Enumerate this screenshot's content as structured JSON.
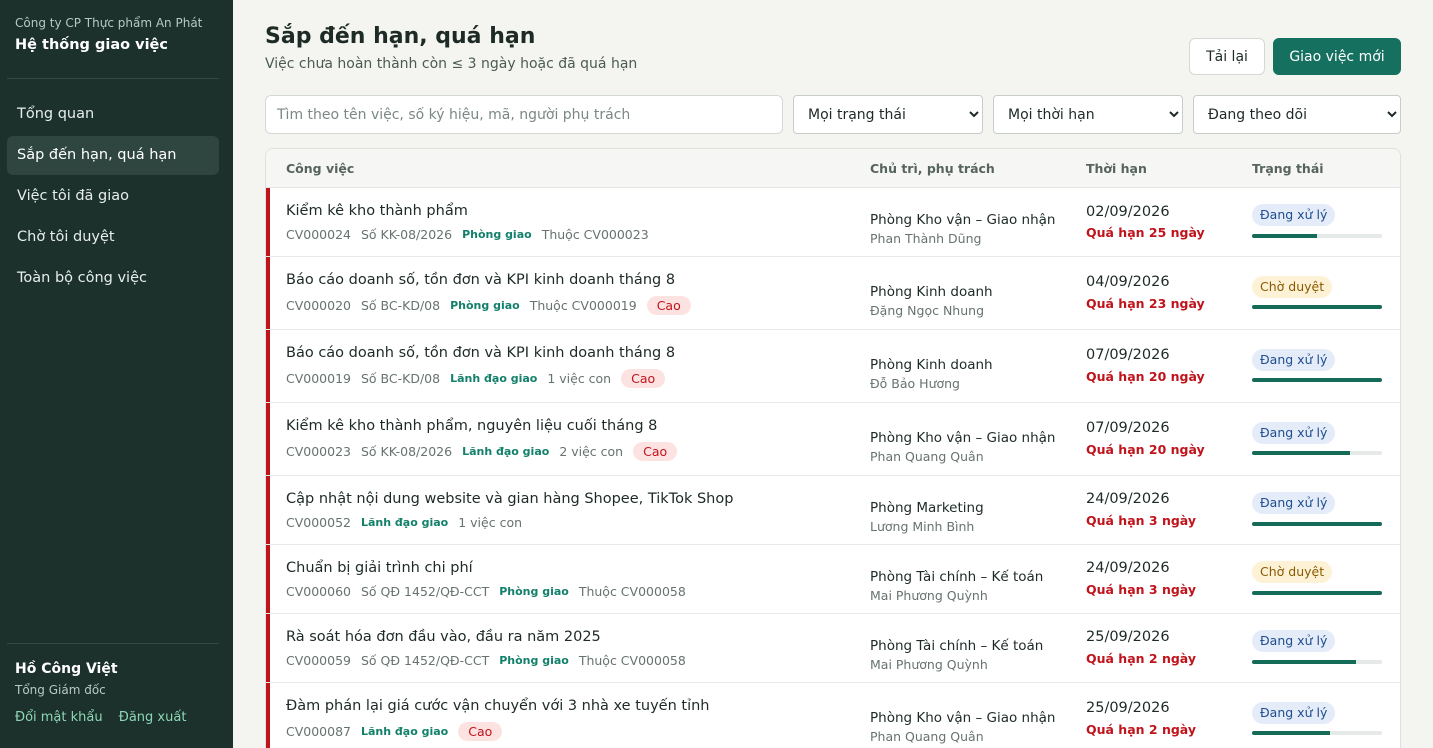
{
  "sidebar": {
    "company": "Công ty CP Thực phẩm An Phát",
    "app_title": "Hệ thống giao việc",
    "nav": [
      "Tổng quan",
      "Sắp đến hạn, quá hạn",
      "Việc tôi đã giao",
      "Chờ tôi duyệt",
      "Toàn bộ công việc"
    ],
    "active_index": 1,
    "user_name": "Hồ Công Việt",
    "user_role": "Tổng Giám đốc",
    "change_password": "Đổi mật khẩu",
    "logout": "Đăng xuất"
  },
  "header": {
    "title": "Sắp đến hạn, quá hạn",
    "subtitle": "Việc chưa hoàn thành còn ≤ 3 ngày hoặc đã quá hạn",
    "reload_label": "Tải lại",
    "new_label": "Giao việc mới"
  },
  "filters": {
    "search_placeholder": "Tìm theo tên việc, số ký hiệu, mã, người phụ trách",
    "status": "Mọi trạng thái",
    "deadline": "Mọi thời hạn",
    "follow": "Đang theo dõi"
  },
  "columns": {
    "task": "Công việc",
    "owner": "Chủ trì, phụ trách",
    "deadline": "Thời hạn",
    "status": "Trạng thái"
  },
  "colors": {
    "sidebar_bg": "#1c302c",
    "accent": "#167060",
    "overdue": "#c0141c"
  },
  "rows": [
    {
      "title": "Kiểm kê kho thành phẩm",
      "meta": [
        "CV000024",
        "Số KK-08/2026"
      ],
      "source": "Phòng giao",
      "extra": "Thuộc CV000023",
      "priority": "",
      "dept": "Phòng Kho vận – Giao nhận",
      "person": "Phan Thành Dũng",
      "date": "02/09/2026",
      "overdue": "Quá hạn 25 ngày",
      "status": "Đang xử lý",
      "status_type": "processing",
      "progress": 0.5
    },
    {
      "title": "Báo cáo doanh số, tồn đơn và KPI kinh doanh tháng 8",
      "meta": [
        "CV000020",
        "Số BC-KD/08"
      ],
      "source": "Phòng giao",
      "extra": "Thuộc CV000019",
      "priority": "Cao",
      "dept": "Phòng Kinh doanh",
      "person": "Đặng Ngọc Nhung",
      "date": "04/09/2026",
      "overdue": "Quá hạn 23 ngày",
      "status": "Chờ duyệt",
      "status_type": "review",
      "progress": 1.0
    },
    {
      "title": "Báo cáo doanh số, tồn đơn và KPI kinh doanh tháng 8",
      "meta": [
        "CV000019",
        "Số BC-KD/08"
      ],
      "source": "Lãnh đạo giao",
      "extra": "1 việc con",
      "priority": "Cao",
      "dept": "Phòng Kinh doanh",
      "person": "Đỗ Bảo Hương",
      "date": "07/09/2026",
      "overdue": "Quá hạn 20 ngày",
      "status": "Đang xử lý",
      "status_type": "processing",
      "progress": 1.0
    },
    {
      "title": "Kiểm kê kho thành phẩm, nguyên liệu cuối tháng 8",
      "meta": [
        "CV000023",
        "Số KK-08/2026"
      ],
      "source": "Lãnh đạo giao",
      "extra": "2 việc con",
      "priority": "Cao",
      "dept": "Phòng Kho vận – Giao nhận",
      "person": "Phan Quang Quân",
      "date": "07/09/2026",
      "overdue": "Quá hạn 20 ngày",
      "status": "Đang xử lý",
      "status_type": "processing",
      "progress": 0.75
    },
    {
      "title": "Cập nhật nội dung website và gian hàng Shopee, TikTok Shop",
      "meta": [
        "CV000052"
      ],
      "source": "Lãnh đạo giao",
      "extra": "1 việc con",
      "priority": "",
      "dept": "Phòng Marketing",
      "person": "Lương Minh Bình",
      "date": "24/09/2026",
      "overdue": "Quá hạn 3 ngày",
      "status": "Đang xử lý",
      "status_type": "processing",
      "progress": 1.0
    },
    {
      "title": "Chuẩn bị giải trình chi phí",
      "meta": [
        "CV000060",
        "Số QĐ 1452/QĐ-CCT"
      ],
      "source": "Phòng giao",
      "extra": "Thuộc CV000058",
      "priority": "",
      "dept": "Phòng Tài chính – Kế toán",
      "person": "Mai Phương Quỳnh",
      "date": "24/09/2026",
      "overdue": "Quá hạn 3 ngày",
      "status": "Chờ duyệt",
      "status_type": "review",
      "progress": 1.0
    },
    {
      "title": "Rà soát hóa đơn đầu vào, đầu ra năm 2025",
      "meta": [
        "CV000059",
        "Số QĐ 1452/QĐ-CCT"
      ],
      "source": "Phòng giao",
      "extra": "Thuộc CV000058",
      "priority": "",
      "dept": "Phòng Tài chính – Kế toán",
      "person": "Mai Phương Quỳnh",
      "date": "25/09/2026",
      "overdue": "Quá hạn 2 ngày",
      "status": "Đang xử lý",
      "status_type": "processing",
      "progress": 0.8
    },
    {
      "title": "Đàm phán lại giá cước vận chuyển với 3 nhà xe tuyến tỉnh",
      "meta": [
        "CV000087"
      ],
      "source": "Lãnh đạo giao",
      "extra": "",
      "priority": "Cao",
      "dept": "Phòng Kho vận – Giao nhận",
      "person": "Phan Quang Quân",
      "date": "25/09/2026",
      "overdue": "Quá hạn 2 ngày",
      "status": "Đang xử lý",
      "status_type": "processing",
      "progress": 0.6
    }
  ]
}
